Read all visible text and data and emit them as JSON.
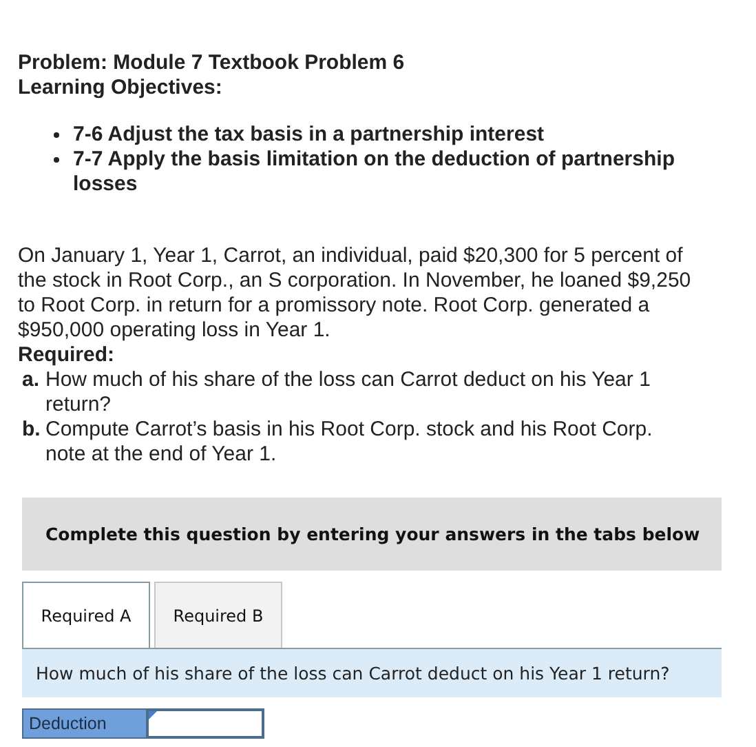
{
  "problem_title": "Problem: Module 7 Textbook Problem 6",
  "objectives_heading": "Learning Objectives:",
  "objectives": [
    "7-6 Adjust the tax basis in a partnership interest",
    "7-7 Apply the basis limitation on the deduction of partnership losses"
  ],
  "scenario": "On January 1, Year 1, Carrot, an individual, paid $20,300 for 5 percent of the stock in Root Corp., an S corporation. In November, he loaned $9,250 to Root Corp. in return for a promissory note. Root Corp. generated a $950,000 operating loss in Year 1.",
  "required_heading": "Required:",
  "requirements": [
    {
      "marker": "a.",
      "text": "How much of his share of the loss can Carrot deduct on his Year 1 return?"
    },
    {
      "marker": "b.",
      "text": "Compute Carrot’s basis in his Root Corp. stock and his Root Corp. note at the end of Year 1."
    }
  ],
  "instruction_banner": "Complete this question by entering your answers in the tabs below",
  "tabs": [
    {
      "label": "Required A",
      "selected": true
    },
    {
      "label": "Required B",
      "selected": false
    }
  ],
  "question": "How much of his share of the loss can Carrot deduct on his Year 1 return?",
  "answer_row": {
    "label": "Deduction"
  }
}
